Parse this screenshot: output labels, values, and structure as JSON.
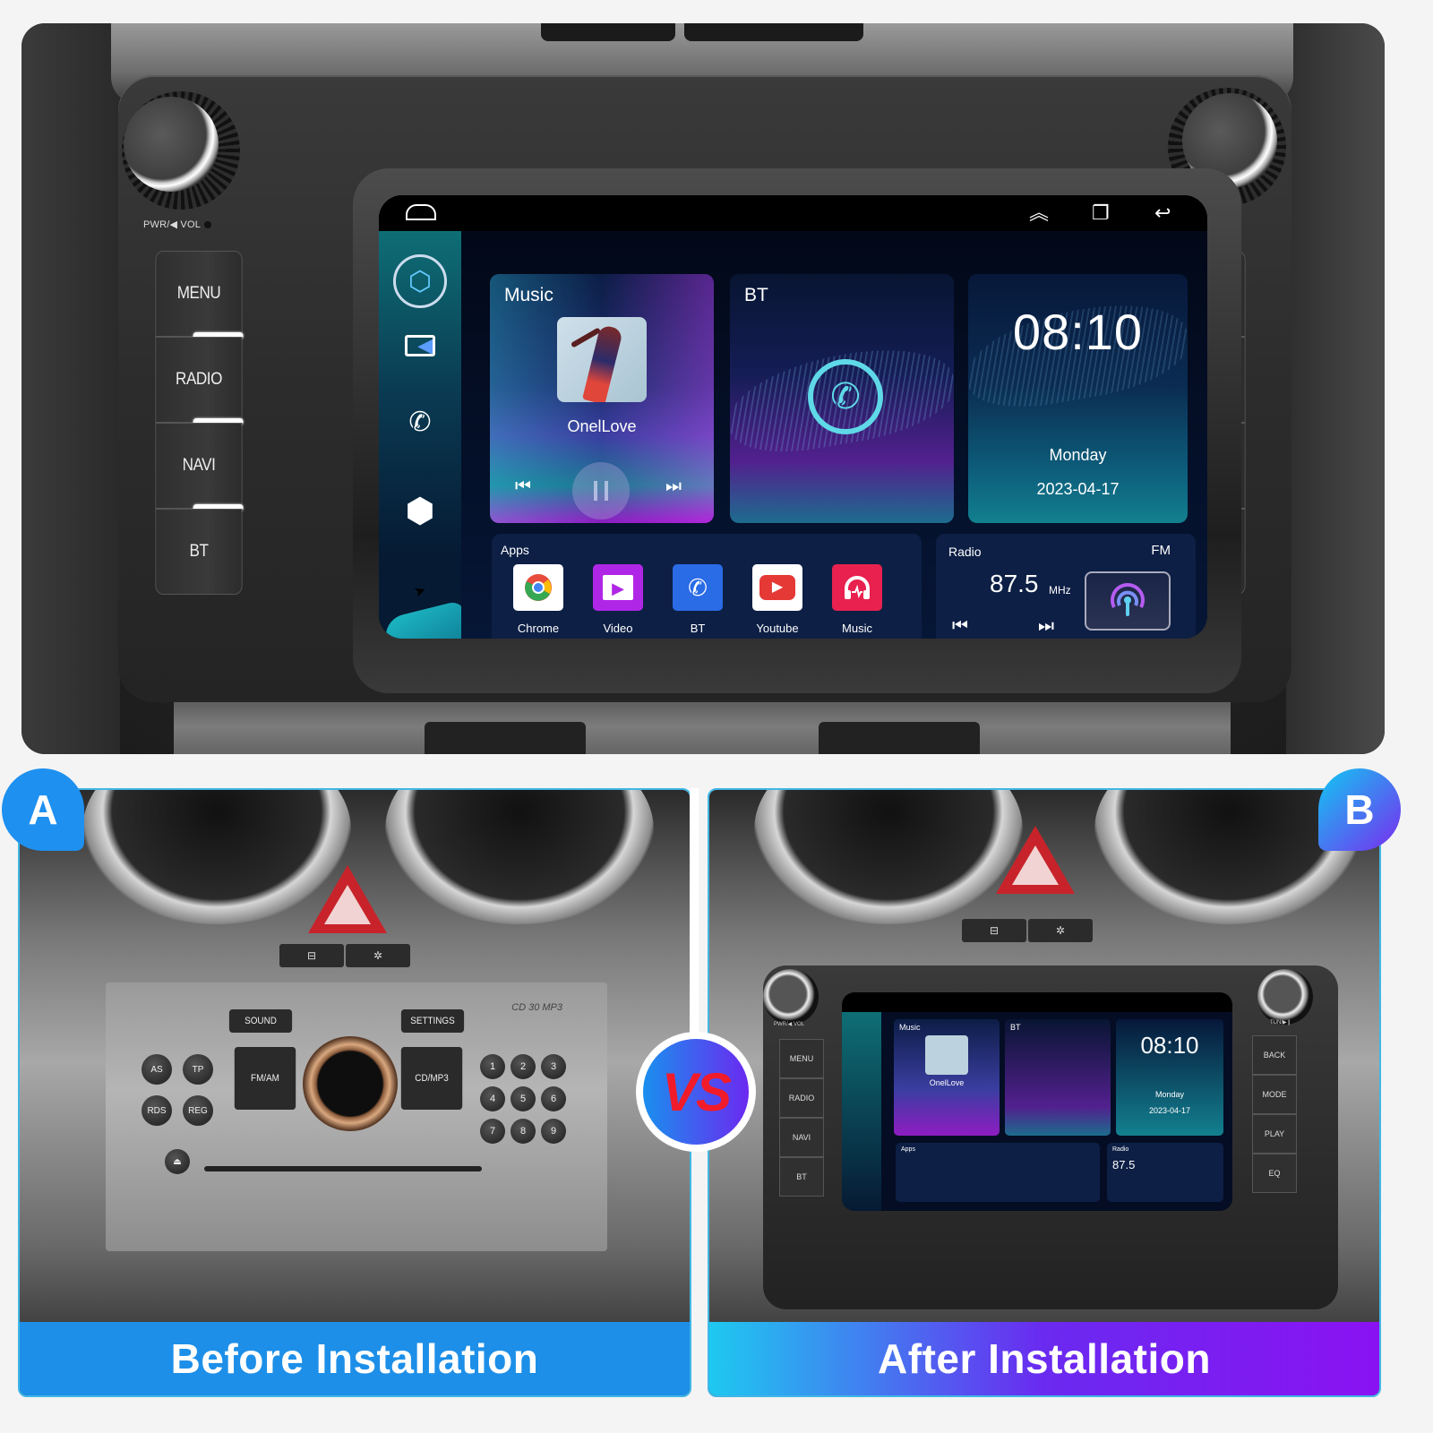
{
  "hero": {
    "knob_left_label": "PWR/◀ VOL",
    "knob_right_label": "TUN/▶❙",
    "left_buttons": [
      "MENU",
      "RADIO",
      "NAVI",
      "BT"
    ],
    "right_buttons": [
      "BACK",
      "MODE",
      "PLAY",
      "EQ"
    ]
  },
  "statusbar": {
    "icons": [
      "home-icon",
      "collapse-up-icon",
      "recent-apps-icon",
      "back-arrow-icon"
    ],
    "glyphs": {
      "collapse": "︽",
      "recent": "❐",
      "back": "↩"
    }
  },
  "dock": {
    "items": [
      "cube-launcher-icon",
      "video-camera-icon",
      "bluetooth-phone-icon",
      "hexagon-settings-icon",
      "paper-plane-nav-icon"
    ],
    "glyphs": {
      "cube": "⬡",
      "video": "◀",
      "phone": "✆",
      "hex": "⬢",
      "plane": "➤"
    }
  },
  "music_card": {
    "title": "Music",
    "song": "OnelLove",
    "prev_glyph": "⏮",
    "next_glyph": "⏭",
    "state": "paused"
  },
  "bt_card": {
    "title": "BT",
    "phone_glyph": "✆"
  },
  "clock_card": {
    "time": "08:10",
    "day": "Monday",
    "date": "2023-04-17"
  },
  "apps_card": {
    "label": "Apps",
    "apps": [
      {
        "name": "Chrome",
        "glyph": "◉",
        "bg": "#ffffff",
        "fg": "#e74c3c"
      },
      {
        "name": "Video",
        "glyph": "▶",
        "bg": "#b026e6",
        "fg": "#ffffff"
      },
      {
        "name": "BT",
        "glyph": "✆",
        "bg": "#2a6be6",
        "fg": "#ffffff"
      },
      {
        "name": "Youtube",
        "glyph": "▶",
        "bg": "#ffffff",
        "fg": "#e53935"
      },
      {
        "name": "Music",
        "glyph": "🎧",
        "bg": "#e8214f",
        "fg": "#ffffff"
      }
    ]
  },
  "radio_card": {
    "label": "Radio",
    "band": "FM",
    "frequency": "87.5",
    "unit": "MHz",
    "prev_glyph": "⏮",
    "next_glyph": "⏭"
  },
  "comparison": {
    "badge_a": "A",
    "badge_b": "B",
    "vs": "VS",
    "caption_a": "Before Installation",
    "caption_b": "After Installation"
  },
  "old_radio": {
    "model": "CD 30 MP3",
    "top_buttons": [
      "SOUND",
      "SETTINGS"
    ],
    "side_buttons": [
      "FM/AM",
      "CD/MP3"
    ],
    "round_buttons": [
      "AS",
      "TP",
      "RDS",
      "REG"
    ],
    "presets": [
      "1",
      "2",
      "3",
      "4",
      "5",
      "6",
      "7",
      "8",
      "9"
    ],
    "eject_glyph": "⏏"
  },
  "colors": {
    "accent_blue": "#1d8fe8",
    "accent_purple": "#8a12f2",
    "screen_teal": "#0e6e75",
    "vs_red": "#f21b2a"
  }
}
